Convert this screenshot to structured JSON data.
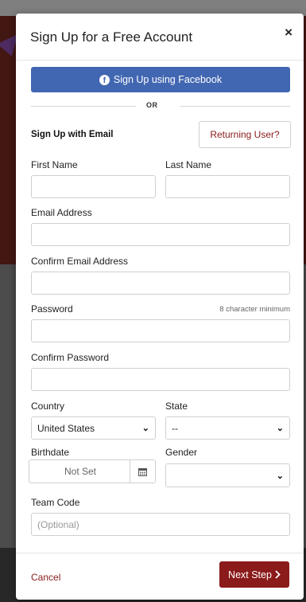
{
  "modal": {
    "title": "Sign Up for a Free Account",
    "close_symbol": "×"
  },
  "facebook": {
    "label": "Sign Up using Facebook",
    "icon": "facebook-icon",
    "color": "#4267b2"
  },
  "divider": {
    "text": "OR"
  },
  "email_section": {
    "heading": "Sign Up with Email",
    "returning_label": "Returning User?"
  },
  "form": {
    "first_name": {
      "label": "First Name",
      "value": "",
      "placeholder": ""
    },
    "last_name": {
      "label": "Last Name",
      "value": "",
      "placeholder": ""
    },
    "email": {
      "label": "Email Address",
      "value": "",
      "placeholder": ""
    },
    "confirm_email": {
      "label": "Confirm Email Address",
      "value": "",
      "placeholder": ""
    },
    "password": {
      "label": "Password",
      "hint": "8 character minimum",
      "value": "",
      "placeholder": ""
    },
    "confirm_password": {
      "label": "Confirm Password",
      "value": "",
      "placeholder": ""
    },
    "country": {
      "label": "Country",
      "selected": "United States"
    },
    "state": {
      "label": "State",
      "selected": "--"
    },
    "birthdate": {
      "label": "Birthdate",
      "value": "Not Set",
      "icon": "calendar-icon"
    },
    "gender": {
      "label": "Gender",
      "selected": ""
    },
    "team_code": {
      "label": "Team Code",
      "placeholder": "(Optional)",
      "value": ""
    }
  },
  "footer": {
    "cancel_label": "Cancel",
    "next_label": "Next Step",
    "next_icon": "chevron-right-icon"
  },
  "colors": {
    "accent": "#8b1a1a",
    "facebook": "#4267b2"
  }
}
